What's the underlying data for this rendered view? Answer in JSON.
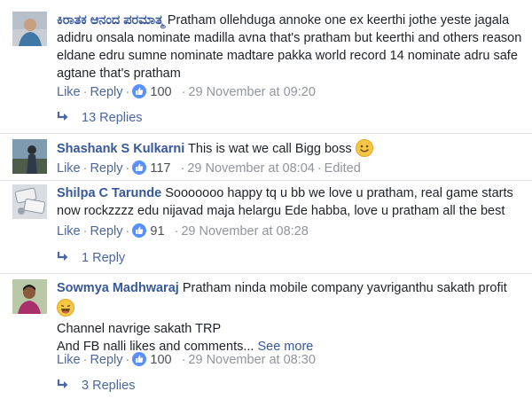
{
  "common": {
    "like_label": "Like",
    "reply_label": "Reply",
    "dot": "·"
  },
  "comments": [
    {
      "author": "ಕಿರಾತಕ ಆನಂದ ಪರಮಾತ್ಮ",
      "text": "Pratham ollehduga annoke one ex keerthi jothe yeste jagala adidru onsala nominate madilla avna that's pratham but keerthi and others reason eldane edru sumne nominate madtare pakka world record 14 nominate adru safe agtane that's pratham",
      "likes": "100",
      "timestamp": "29 November at 09:20",
      "replies": "13 Replies"
    },
    {
      "author": "Shashank S Kulkarni",
      "text": "This is wat we call Bigg boss",
      "likes": "117",
      "timestamp": "29 November at 08:04",
      "edited": "Edited"
    },
    {
      "author": "Shilpa C Tarunde",
      "text": "Sooooooo happy tq u bb we love u pratham, real game starts now rockzzzz edu nijavad maja helargu Ede habba, love u pratham all the best",
      "likes": "91",
      "timestamp": "29 November at 08:28",
      "replies": "1 Reply"
    },
    {
      "author": "Sowmya Madhwaraj",
      "text": "Pratham ninda mobile company yavriganthu sakath profit",
      "line2": "Channel navrige sakath TRP",
      "line3": "And FB nalli likes and comments...",
      "see_more": "See more",
      "likes": "100",
      "timestamp": "29 November at 08:30",
      "replies": "3 Replies"
    }
  ],
  "colors": {
    "author": "#365899",
    "link": "#4b67a1",
    "meta": "#90949c",
    "like_blue": "#5890ff",
    "divider": "#e1e2e5"
  }
}
